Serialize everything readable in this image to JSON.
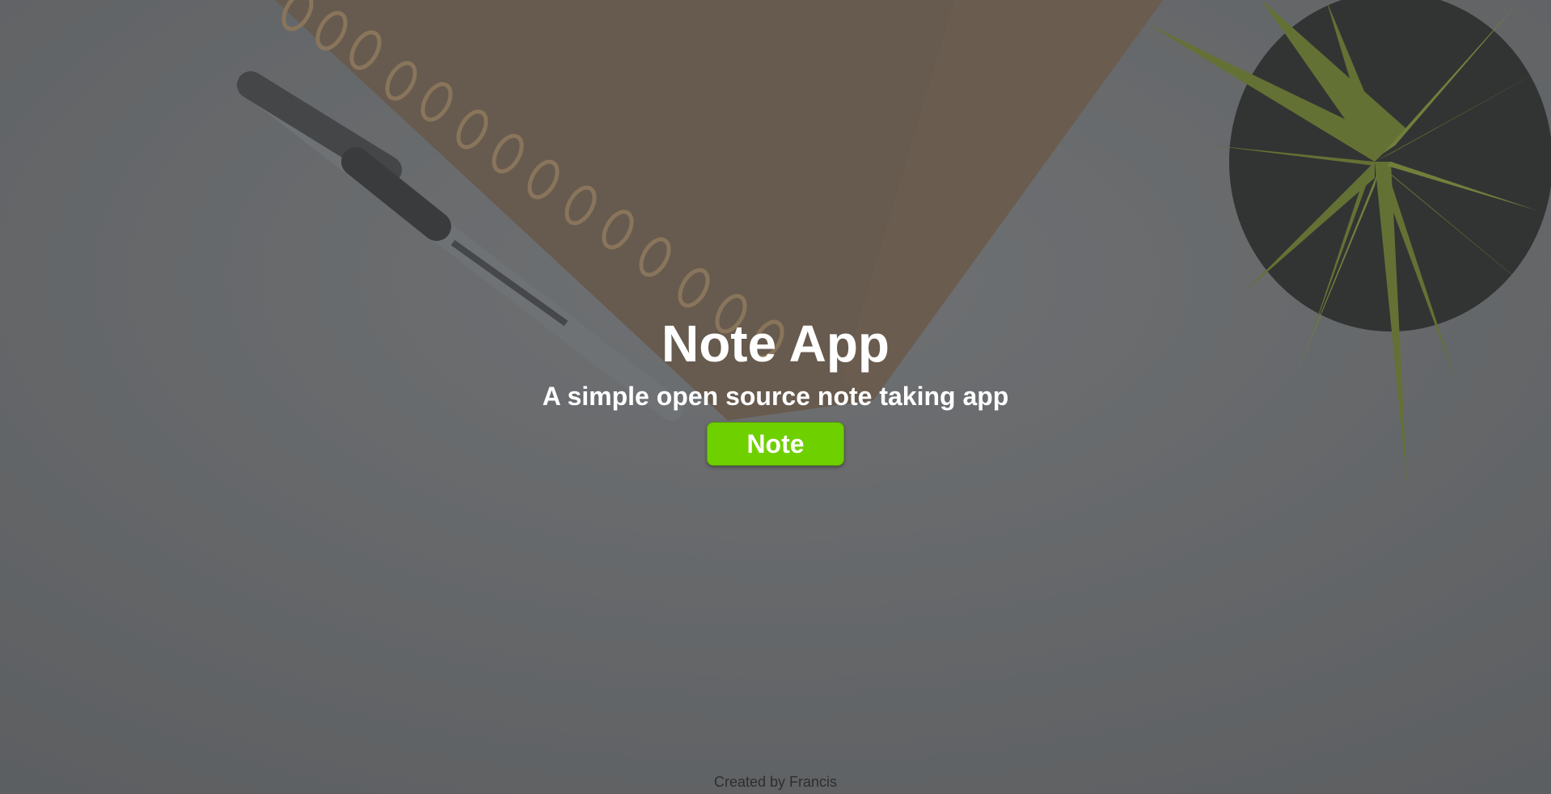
{
  "hero": {
    "title": "Note App",
    "subtitle": "A simple open source note taking app",
    "button_label": "Note"
  },
  "footer": {
    "credit": "Created by Francis"
  },
  "colors": {
    "overlay": "#6a6c6e",
    "accent": "#6fd000",
    "text": "#ffffff"
  },
  "icons": {
    "background": "desk-photo-notebook-pen-plant"
  }
}
